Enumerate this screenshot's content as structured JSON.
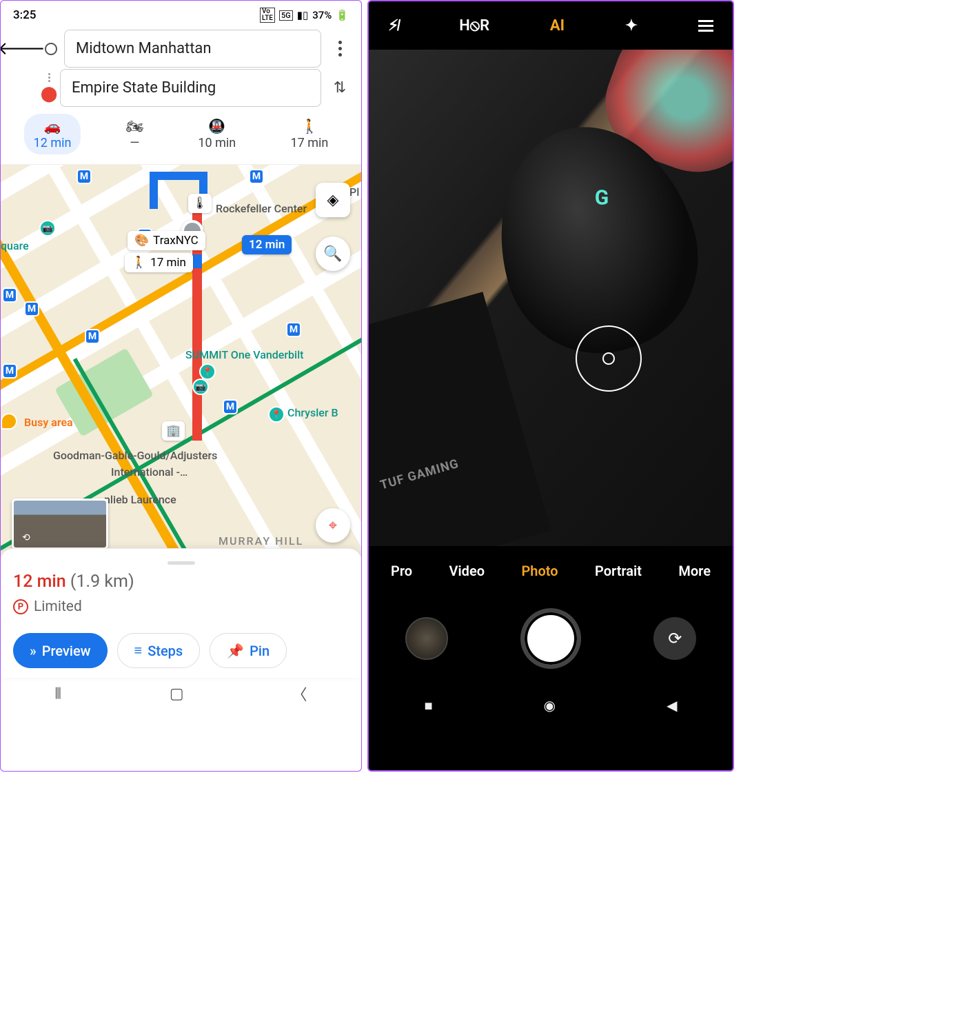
{
  "left": {
    "status": {
      "time": "3:25",
      "battery": "37%",
      "net": "5G",
      "volt": "Vo LTE"
    },
    "route": {
      "origin": "Midtown Manhattan",
      "destination": "Empire State Building"
    },
    "modes": {
      "drive": "12 min",
      "bike": "—",
      "transit": "10 min",
      "walk": "17 min"
    },
    "map": {
      "rockefeller": "Rockefeller Center",
      "traxnyc": "TraxNYC",
      "walk_chip": "17 min",
      "drive_chip": "12 min",
      "summit": "SUMMIT One Vanderbilt",
      "chrysler": "Chrysler B",
      "busy": "Busy area",
      "goodman": "Goodman-Gable-Gould/Adjusters",
      "goodman2": "International -…",
      "laurence": "nlieb Laurence",
      "murray": "MURRAY HILL",
      "square": "quare",
      "pl": "Pl"
    },
    "sheet": {
      "time": "12 min",
      "dist": "(1.9 km)",
      "parking": "Limited"
    },
    "actions": {
      "preview": "Preview",
      "steps": "Steps",
      "pin": "Pin"
    }
  },
  "right": {
    "top": {
      "hdr": "H⦸R",
      "ai": "AI"
    },
    "viewfinder": {
      "logo_brand": "TUF GAMING"
    },
    "modes": {
      "pro": "Pro",
      "video": "Video",
      "photo": "Photo",
      "portrait": "Portrait",
      "more": "More"
    }
  }
}
